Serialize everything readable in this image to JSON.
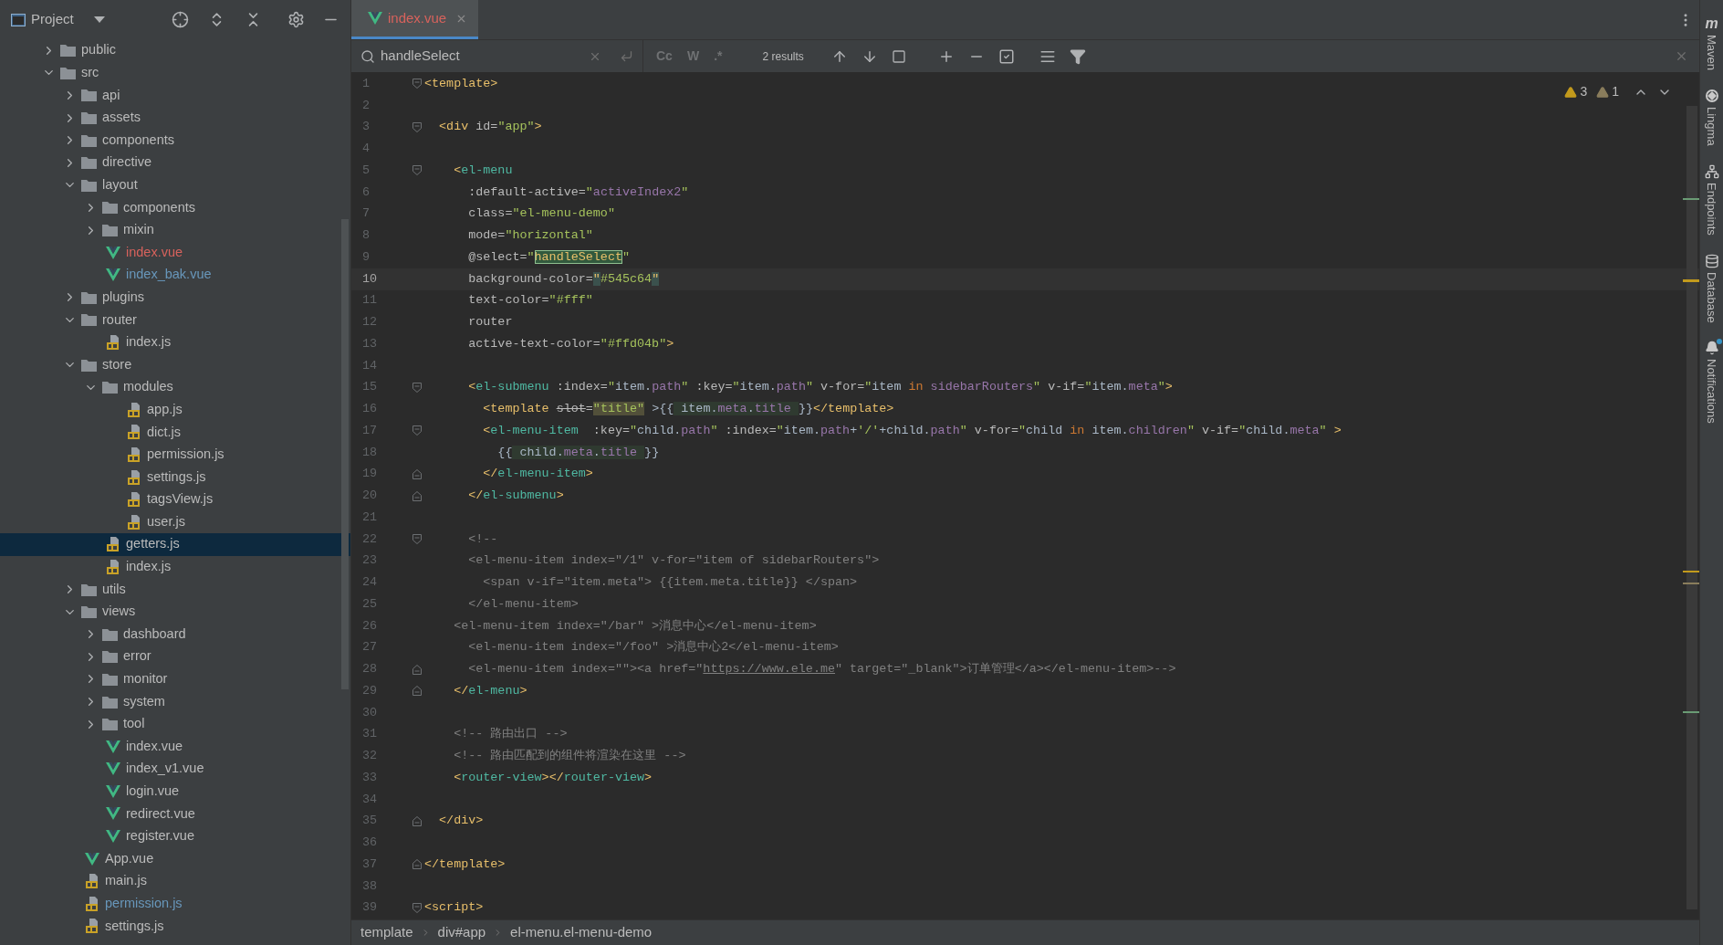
{
  "sidebar": {
    "title": "Project",
    "tree": [
      {
        "name": "public",
        "kind": "folder",
        "expanded": false,
        "selected": false
      },
      {
        "name": "src",
        "kind": "folder",
        "expanded": true,
        "selected": false,
        "children": [
          {
            "name": "api",
            "kind": "folder",
            "expanded": false,
            "selected": false
          },
          {
            "name": "assets",
            "kind": "folder",
            "expanded": false,
            "selected": false
          },
          {
            "name": "components",
            "kind": "folder",
            "expanded": false,
            "selected": false
          },
          {
            "name": "directive",
            "kind": "folder",
            "expanded": false,
            "selected": false
          },
          {
            "name": "layout",
            "kind": "folder",
            "expanded": true,
            "selected": false,
            "children": [
              {
                "name": "components",
                "kind": "folder",
                "expanded": false,
                "selected": false
              },
              {
                "name": "mixin",
                "kind": "folder",
                "expanded": false,
                "selected": false
              },
              {
                "name": "index.vue",
                "kind": "vue",
                "selected": false,
                "color": "#d7625c"
              },
              {
                "name": "index_bak.vue",
                "kind": "vue",
                "selected": false,
                "color": "#6897bb"
              }
            ]
          },
          {
            "name": "plugins",
            "kind": "folder",
            "expanded": false,
            "selected": false
          },
          {
            "name": "router",
            "kind": "folder",
            "expanded": true,
            "selected": false,
            "children": [
              {
                "name": "index.js",
                "kind": "js",
                "selected": false
              }
            ]
          },
          {
            "name": "store",
            "kind": "folder",
            "expanded": true,
            "selected": false,
            "children": [
              {
                "name": "modules",
                "kind": "folder",
                "expanded": true,
                "selected": false,
                "children": [
                  {
                    "name": "app.js",
                    "kind": "js",
                    "selected": false
                  },
                  {
                    "name": "dict.js",
                    "kind": "js",
                    "selected": false
                  },
                  {
                    "name": "permission.js",
                    "kind": "js",
                    "selected": false
                  },
                  {
                    "name": "settings.js",
                    "kind": "js",
                    "selected": false
                  },
                  {
                    "name": "tagsView.js",
                    "kind": "js",
                    "selected": false
                  },
                  {
                    "name": "user.js",
                    "kind": "js",
                    "selected": false
                  }
                ]
              },
              {
                "name": "getters.js",
                "kind": "js",
                "selected": true
              },
              {
                "name": "index.js",
                "kind": "js",
                "selected": false
              }
            ]
          },
          {
            "name": "utils",
            "kind": "folder",
            "expanded": false,
            "selected": false
          },
          {
            "name": "views",
            "kind": "folder",
            "expanded": true,
            "selected": false,
            "children": [
              {
                "name": "dashboard",
                "kind": "folder",
                "expanded": false,
                "selected": false
              },
              {
                "name": "error",
                "kind": "folder",
                "expanded": false,
                "selected": false
              },
              {
                "name": "monitor",
                "kind": "folder",
                "expanded": false,
                "selected": false
              },
              {
                "name": "system",
                "kind": "folder",
                "expanded": false,
                "selected": false
              },
              {
                "name": "tool",
                "kind": "folder",
                "expanded": false,
                "selected": false
              },
              {
                "name": "index.vue",
                "kind": "vue",
                "selected": false
              },
              {
                "name": "index_v1.vue",
                "kind": "vue",
                "selected": false
              },
              {
                "name": "login.vue",
                "kind": "vue",
                "selected": false
              },
              {
                "name": "redirect.vue",
                "kind": "vue",
                "selected": false
              },
              {
                "name": "register.vue",
                "kind": "vue",
                "selected": false
              }
            ]
          },
          {
            "name": "App.vue",
            "kind": "vue",
            "selected": false
          },
          {
            "name": "main.js",
            "kind": "js",
            "selected": false
          },
          {
            "name": "permission.js",
            "kind": "js",
            "selected": false,
            "color": "#6897bb"
          },
          {
            "name": "settings.js",
            "kind": "js",
            "selected": false
          }
        ]
      }
    ]
  },
  "tabs": [
    {
      "label": "index.vue",
      "selected": true,
      "color": "#d7625c"
    }
  ],
  "search": {
    "query": "handleSelect",
    "options": [
      {
        "label": "Cc",
        "selected": false
      },
      {
        "label": "W",
        "selected": false
      },
      {
        "label": ".*",
        "selected": false
      }
    ],
    "results": "2 results"
  },
  "inspections": [
    {
      "kind": "warning",
      "count": "3"
    },
    {
      "kind": "weak_warning",
      "count": "1"
    }
  ],
  "code": {
    "lines": [
      {
        "n": "1",
        "current": false,
        "fold_open": true,
        "tokens": [
          {
            "kind": "tag",
            "s": "<template>"
          }
        ]
      },
      {
        "n": "2",
        "current": false
      },
      {
        "n": "3",
        "current": false,
        "fold_open": true,
        "tokens": [
          {
            "kind": "tag",
            "s": "  <div"
          },
          {
            "kind": "attr",
            "s": " id="
          },
          {
            "kind": "str",
            "s": "\"app\""
          },
          {
            "kind": "tag",
            "s": ">"
          }
        ]
      },
      {
        "n": "4",
        "current": false
      },
      {
        "n": "5",
        "current": false,
        "fold_open": true,
        "tokens": [
          {
            "kind": "tag",
            "s": "    <"
          },
          {
            "kind": "comp",
            "s": "el-menu"
          }
        ]
      },
      {
        "n": "6",
        "current": false,
        "tokens": [
          {
            "kind": "attr",
            "s": "      :default-active="
          },
          {
            "kind": "str",
            "s": "\""
          },
          {
            "kind": "field",
            "s": "activeIndex2"
          },
          {
            "kind": "str",
            "s": "\""
          }
        ]
      },
      {
        "n": "7",
        "current": false,
        "tokens": [
          {
            "kind": "attr",
            "s": "      class="
          },
          {
            "kind": "str",
            "s": "\"el-menu-demo\""
          }
        ]
      },
      {
        "n": "8",
        "current": false,
        "tokens": [
          {
            "kind": "attr",
            "s": "      mode="
          },
          {
            "kind": "str",
            "s": "\"horizontal\""
          }
        ]
      },
      {
        "n": "9",
        "current": false,
        "tokens": [
          {
            "kind": "attr",
            "s": "      @select="
          },
          {
            "kind": "str",
            "s": "\""
          },
          {
            "kind": "tag",
            "s": "handleSelect",
            "search_match": true
          },
          {
            "kind": "str",
            "s": "\""
          }
        ]
      },
      {
        "n": "10",
        "current": true,
        "tokens": [
          {
            "kind": "attr",
            "s": "      background-color="
          },
          {
            "kind": "tag",
            "s": "\"",
            "brace_pair": true
          },
          {
            "kind": "str",
            "s": "#545c64"
          },
          {
            "kind": "tag",
            "s": "\"",
            "brace_pair": true
          }
        ]
      },
      {
        "n": "11",
        "current": false,
        "tokens": [
          {
            "kind": "attr",
            "s": "      text-color="
          },
          {
            "kind": "str",
            "s": "\"#fff\""
          }
        ]
      },
      {
        "n": "12",
        "current": false,
        "tokens": [
          {
            "kind": "attr",
            "s": "      router"
          }
        ]
      },
      {
        "n": "13",
        "current": false,
        "tokens": [
          {
            "kind": "attr",
            "s": "      active-text-color="
          },
          {
            "kind": "str",
            "s": "\"#ffd04b\""
          },
          {
            "kind": "tag",
            "s": ">"
          }
        ]
      },
      {
        "n": "14",
        "current": false
      },
      {
        "n": "15",
        "current": false,
        "fold_open": true,
        "tokens": [
          {
            "kind": "tag",
            "s": "      <"
          },
          {
            "kind": "comp",
            "s": "el-submenu"
          },
          {
            "kind": "attr",
            "s": " :index="
          },
          {
            "kind": "str",
            "s": "\""
          },
          {
            "kind": "plain",
            "s": "item."
          },
          {
            "kind": "field",
            "s": "path"
          },
          {
            "kind": "str",
            "s": "\""
          },
          {
            "kind": "attr",
            "s": " :key="
          },
          {
            "kind": "str",
            "s": "\""
          },
          {
            "kind": "plain",
            "s": "item."
          },
          {
            "kind": "field",
            "s": "path"
          },
          {
            "kind": "str",
            "s": "\""
          },
          {
            "kind": "attr",
            "s": " v-for="
          },
          {
            "kind": "str",
            "s": "\""
          },
          {
            "kind": "plain",
            "s": "item "
          },
          {
            "kind": "kw",
            "s": "in"
          },
          {
            "kind": "field",
            "s": " sidebarRouters"
          },
          {
            "kind": "str",
            "s": "\""
          },
          {
            "kind": "attr",
            "s": " v-if="
          },
          {
            "kind": "str",
            "s": "\""
          },
          {
            "kind": "plain",
            "s": "item."
          },
          {
            "kind": "field",
            "s": "meta"
          },
          {
            "kind": "str",
            "s": "\""
          },
          {
            "kind": "tag",
            "s": ">"
          }
        ]
      },
      {
        "n": "16",
        "current": false,
        "tokens": [
          {
            "kind": "tag",
            "s": "        <template "
          },
          {
            "kind": "strike",
            "s": "slot"
          },
          {
            "kind": "attr",
            "s": "="
          },
          {
            "kind": "str",
            "s": "\"title\"",
            "slot_value": true
          },
          {
            "kind": "plain",
            "s": " >{{"
          },
          {
            "kind": "plain",
            "s": " item.",
            "injected": true
          },
          {
            "kind": "field",
            "s": "meta",
            "injected": true
          },
          {
            "kind": "plain",
            "s": ".",
            "injected": true
          },
          {
            "kind": "field",
            "s": "title ",
            "injected": true
          },
          {
            "kind": "plain",
            "s": "}}"
          },
          {
            "kind": "tag",
            "s": "</template>"
          }
        ]
      },
      {
        "n": "17",
        "current": false,
        "fold_open": true,
        "tokens": [
          {
            "kind": "tag",
            "s": "        <"
          },
          {
            "kind": "comp",
            "s": "el-menu-item"
          },
          {
            "kind": "attr",
            "s": "  :key="
          },
          {
            "kind": "str",
            "s": "\""
          },
          {
            "kind": "plain",
            "s": "child."
          },
          {
            "kind": "field",
            "s": "path"
          },
          {
            "kind": "str",
            "s": "\""
          },
          {
            "kind": "attr",
            "s": " :index="
          },
          {
            "kind": "str",
            "s": "\""
          },
          {
            "kind": "plain",
            "s": "item."
          },
          {
            "kind": "field",
            "s": "path"
          },
          {
            "kind": "plain",
            "s": "+"
          },
          {
            "kind": "str",
            "s": "'/'"
          },
          {
            "kind": "plain",
            "s": "+child."
          },
          {
            "kind": "field",
            "s": "path"
          },
          {
            "kind": "str",
            "s": "\""
          },
          {
            "kind": "attr",
            "s": " v-for="
          },
          {
            "kind": "str",
            "s": "\""
          },
          {
            "kind": "plain",
            "s": "child "
          },
          {
            "kind": "kw",
            "s": "in"
          },
          {
            "kind": "plain",
            "s": " item."
          },
          {
            "kind": "field",
            "s": "children"
          },
          {
            "kind": "str",
            "s": "\""
          },
          {
            "kind": "attr",
            "s": " v-if="
          },
          {
            "kind": "str",
            "s": "\""
          },
          {
            "kind": "plain",
            "s": "child."
          },
          {
            "kind": "field",
            "s": "meta"
          },
          {
            "kind": "str",
            "s": "\""
          },
          {
            "kind": "tag",
            "s": " >"
          }
        ]
      },
      {
        "n": "18",
        "current": false,
        "tokens": [
          {
            "kind": "plain",
            "s": "          {{"
          },
          {
            "kind": "plain",
            "s": " child.",
            "injected": true
          },
          {
            "kind": "field",
            "s": "meta",
            "injected": true
          },
          {
            "kind": "plain",
            "s": ".",
            "injected": true
          },
          {
            "kind": "field",
            "s": "title ",
            "injected": true
          },
          {
            "kind": "plain",
            "s": "}}"
          }
        ]
      },
      {
        "n": "19",
        "current": false,
        "fold_close": true,
        "tokens": [
          {
            "kind": "tag",
            "s": "        </"
          },
          {
            "kind": "comp",
            "s": "el-menu-item"
          },
          {
            "kind": "tag",
            "s": ">"
          }
        ]
      },
      {
        "n": "20",
        "current": false,
        "fold_close": true,
        "tokens": [
          {
            "kind": "tag",
            "s": "      </"
          },
          {
            "kind": "comp",
            "s": "el-submenu"
          },
          {
            "kind": "tag",
            "s": ">"
          }
        ]
      },
      {
        "n": "21",
        "current": false
      },
      {
        "n": "22",
        "current": false,
        "fold_open": true,
        "tokens": [
          {
            "kind": "comment",
            "s": "      <!--"
          }
        ]
      },
      {
        "n": "23",
        "current": false,
        "tokens": [
          {
            "kind": "comment",
            "s": "      <el-menu-item index=\"/1\" v-for=\"item of sidebarRouters\">"
          }
        ]
      },
      {
        "n": "24",
        "current": false,
        "tokens": [
          {
            "kind": "comment",
            "s": "        <span v-if=\"item.meta\"> {{item.meta.title}} </span>"
          }
        ]
      },
      {
        "n": "25",
        "current": false,
        "tokens": [
          {
            "kind": "comment",
            "s": "      </el-menu-item>"
          }
        ]
      },
      {
        "n": "26",
        "current": false,
        "tokens": [
          {
            "kind": "comment",
            "s": "    <el-menu-item index=\"/bar\" >消息中心</el-menu-item>"
          }
        ]
      },
      {
        "n": "27",
        "current": false,
        "tokens": [
          {
            "kind": "comment",
            "s": "      <el-menu-item index=\"/foo\" >消息中心2</el-menu-item>"
          }
        ]
      },
      {
        "n": "28",
        "current": false,
        "fold_close": true,
        "tokens": [
          {
            "kind": "comment",
            "s": "      <el-menu-item index=\"\"><a href=\""
          },
          {
            "kind": "link",
            "s": "https://www.ele.me"
          },
          {
            "kind": "comment",
            "s": "\" target=\"_blank\">订单管理</a></el-menu-item>-->"
          }
        ]
      },
      {
        "n": "29",
        "current": false,
        "fold_close": true,
        "tokens": [
          {
            "kind": "tag",
            "s": "    </"
          },
          {
            "kind": "comp",
            "s": "el-menu"
          },
          {
            "kind": "tag",
            "s": ">"
          }
        ]
      },
      {
        "n": "30",
        "current": false
      },
      {
        "n": "31",
        "current": false,
        "tokens": [
          {
            "kind": "comment",
            "s": "    <!-- 路由出口 -->"
          }
        ]
      },
      {
        "n": "32",
        "current": false,
        "tokens": [
          {
            "kind": "comment",
            "s": "    <!-- 路由匹配到的组件将渲染在这里 -->"
          }
        ]
      },
      {
        "n": "33",
        "current": false,
        "tokens": [
          {
            "kind": "tag",
            "s": "    <"
          },
          {
            "kind": "comp",
            "s": "router-view"
          },
          {
            "kind": "tag",
            "s": "></"
          },
          {
            "kind": "comp",
            "s": "router-view"
          },
          {
            "kind": "tag",
            "s": ">"
          }
        ]
      },
      {
        "n": "34",
        "current": false
      },
      {
        "n": "35",
        "current": false,
        "fold_close": true,
        "tokens": [
          {
            "kind": "tag",
            "s": "  </div>"
          }
        ]
      },
      {
        "n": "36",
        "current": false
      },
      {
        "n": "37",
        "current": false,
        "fold_close": true,
        "tokens": [
          {
            "kind": "tag",
            "s": "</template>"
          }
        ]
      },
      {
        "n": "38",
        "current": false
      },
      {
        "n": "39",
        "current": false,
        "fold_open": true,
        "tokens": [
          {
            "kind": "tag",
            "s": "<script>"
          }
        ]
      }
    ]
  },
  "breadcrumbs": [
    "template",
    "div#app",
    "el-menu.el-menu-demo"
  ],
  "tool_stripe": [
    {
      "kind": "maven",
      "glyph": "m",
      "label": "Maven"
    },
    {
      "kind": "lingma",
      "label": "Lingma"
    },
    {
      "kind": "endpoints",
      "label": "Endpoints"
    },
    {
      "kind": "database",
      "label": "Database"
    },
    {
      "kind": "notifications",
      "label": "Notifications",
      "badge": true
    }
  ]
}
